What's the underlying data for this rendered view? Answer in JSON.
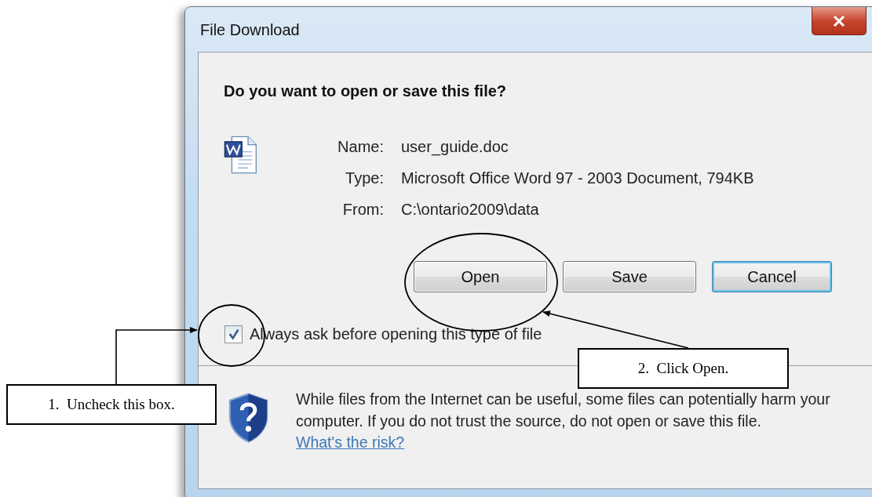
{
  "window": {
    "title": "File Download"
  },
  "heading": "Do you want to open or save this file?",
  "file_info": [
    {
      "label": "Name:",
      "value": "user_guide.doc"
    },
    {
      "label": "Type:",
      "value": "Microsoft Office Word 97 - 2003 Document, 794KB"
    },
    {
      "label": "From:",
      "value": "C:\\ontario2009\\data"
    }
  ],
  "buttons": [
    {
      "label": "Open",
      "default": false
    },
    {
      "label": "Save",
      "default": false
    },
    {
      "label": "Cancel",
      "default": true
    }
  ],
  "checkbox": {
    "label": "Always ask before opening this type of file",
    "checked": true
  },
  "warning": {
    "text": "While files from the Internet can be useful, some files can potentially harm your computer. If you do not trust the source, do not open or save this file.",
    "link": "What's the risk?"
  },
  "annotations": [
    {
      "text": "1.  Uncheck this box."
    },
    {
      "text": "2.  Click Open."
    }
  ]
}
